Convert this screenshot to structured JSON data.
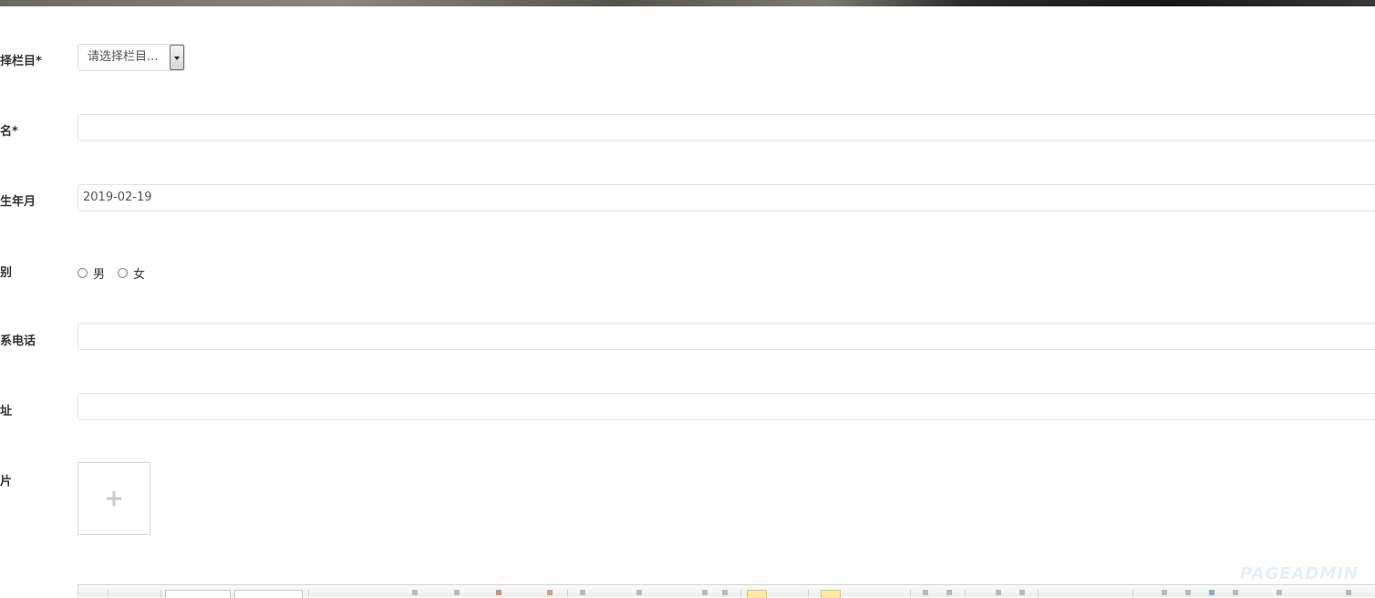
{
  "form": {
    "column": {
      "label": "择栏目*",
      "select_value": "请选择栏目..."
    },
    "name": {
      "label": "名*",
      "value": ""
    },
    "birth": {
      "label": "生年月",
      "value": "2019-02-19"
    },
    "gender": {
      "label": "别",
      "options": [
        "男",
        "女"
      ]
    },
    "phone": {
      "label": "系电话",
      "value": ""
    },
    "address": {
      "label": "址",
      "value": ""
    },
    "photo": {
      "label": "片",
      "upload_symbol": "+"
    }
  },
  "watermark": "PAGEADMIN",
  "icons": {
    "upload": "plus-icon",
    "select_arrow": "chevron-down-icon"
  }
}
